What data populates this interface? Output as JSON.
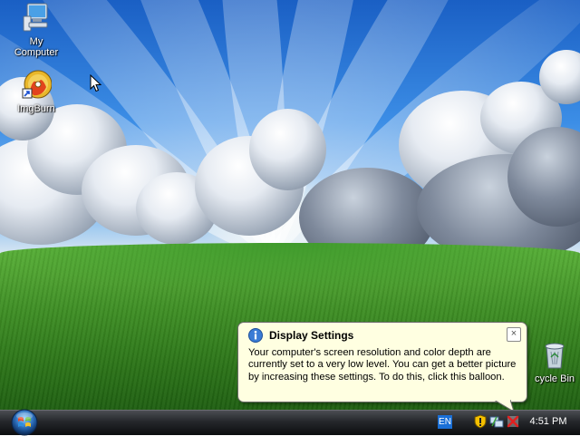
{
  "desktop": {
    "icons": [
      {
        "label_line1": "My",
        "label_line2": "Computer",
        "icon": "computer-icon"
      },
      {
        "label": "ImgBurn",
        "icon": "imgburn-icon"
      },
      {
        "label": "cycle Bin",
        "icon": "recycle-bin-icon"
      }
    ]
  },
  "balloon": {
    "title": "Display Settings",
    "text": "Your computer's screen resolution and color depth are currently set to a very low level. You can get a better picture by increasing these settings. To do this, click this balloon.",
    "close_glyph": "×",
    "icon": "info-icon"
  },
  "taskbar": {
    "start_icon": "windows-start-orb",
    "language": "EN",
    "tray_icons": [
      "security-shield-icon",
      "network-icon",
      "network-error-icon"
    ],
    "clock": "4:51 PM"
  }
}
